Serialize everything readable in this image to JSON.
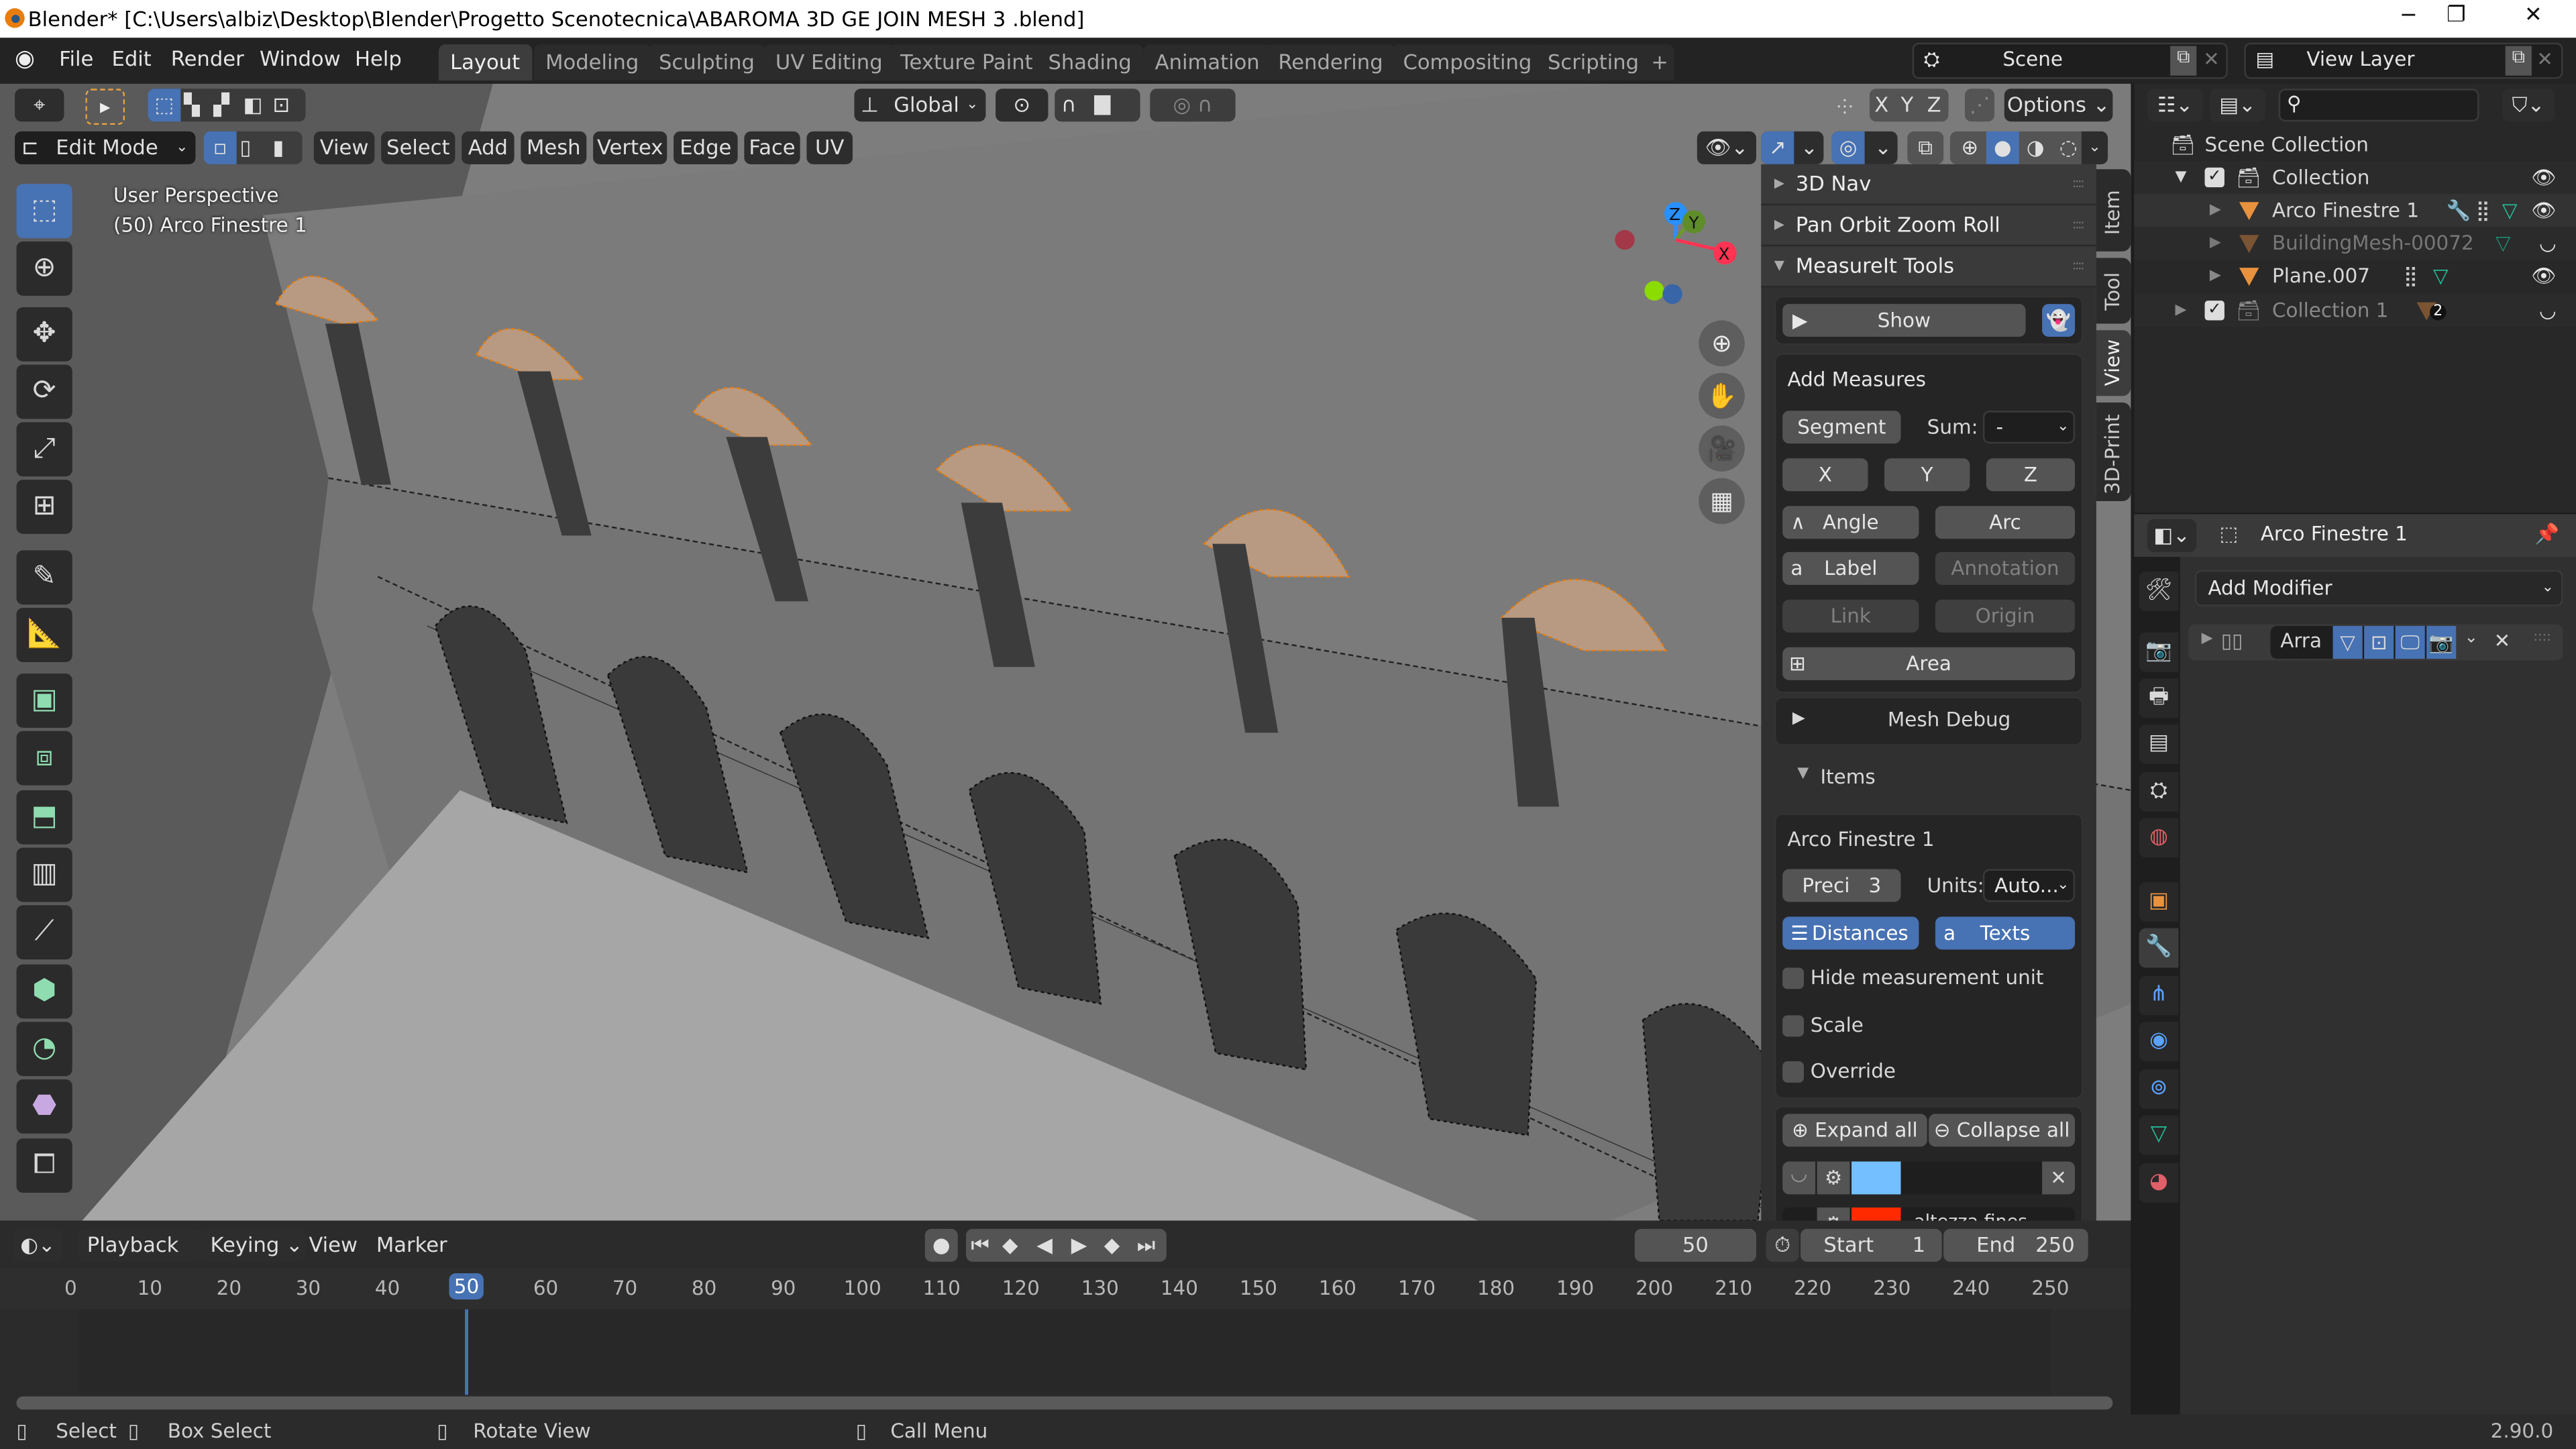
{
  "window": {
    "title": "Blender* [C:\\Users\\albiz\\Desktop\\Blender\\Progetto Scenotecnica\\ABAROMA 3D GE JOIN MESH 3 .blend]",
    "minimize_icon": "−",
    "maximize_icon": "❐",
    "close_icon": "✕"
  },
  "menu": {
    "items": [
      "File",
      "Edit",
      "Render",
      "Window",
      "Help"
    ],
    "workspaces": [
      "Layout",
      "Modeling",
      "Sculpting",
      "UV Editing",
      "Texture Paint",
      "Shading",
      "Animation",
      "Rendering",
      "Compositing",
      "Scripting"
    ],
    "active_workspace": "Layout",
    "add_workspace": "+",
    "scene": "Scene",
    "view_layer": "View Layer"
  },
  "viewport": {
    "mode": "Edit Mode",
    "menus": [
      "View",
      "Select",
      "Add",
      "Mesh",
      "Vertex",
      "Edge",
      "Face",
      "UV"
    ],
    "transform_orientation": "Global",
    "mirror_axes": [
      "X",
      "Y",
      "Z"
    ],
    "options_label": "Options",
    "overlay_text_line1": "User Perspective",
    "overlay_text_line2": "(50) Arco Finestre 1",
    "gizmo": {
      "x": "X",
      "y": "Y",
      "z": "Z",
      "colors": {
        "x": "#ff3352",
        "y": "#8bdc00",
        "z": "#2890ff"
      }
    }
  },
  "toolbar_tools": [
    "Select Box",
    "Cursor",
    "Move",
    "Rotate",
    "Scale",
    "Transform",
    "Annotate",
    "Measure",
    "Extrude Region",
    "Inset Faces",
    "Bevel",
    "Loop Cut",
    "Knife",
    "Poly Build",
    "Spin",
    "Smooth",
    "Edge Slide",
    "Shrink/Fatten"
  ],
  "npanel": {
    "tabs": [
      "Item",
      "Tool",
      "View",
      "3D-Print"
    ],
    "active_tab": "View",
    "sections": [
      {
        "label": "3D Nav",
        "expanded": false
      },
      {
        "label": "Pan Orbit Zoom Roll",
        "expanded": false
      },
      {
        "label": "MeasureIt Tools",
        "expanded": true
      }
    ],
    "show_button": "Show",
    "add_measures": {
      "title": "Add Measures",
      "segment": "Segment",
      "sum_label": "Sum:",
      "sum_value": "-",
      "axes": [
        "X",
        "Y",
        "Z"
      ],
      "angle": "Angle",
      "arc": "Arc",
      "label": "Label",
      "annotation": "Annotation",
      "link": "Link",
      "origin": "Origin",
      "area": "Area"
    },
    "mesh_debug": "Mesh Debug",
    "items_label": "Items",
    "items": {
      "object_name": "Arco Finestre 1",
      "precision_label": "Preci",
      "precision_value": "3",
      "units_label": "Units:",
      "units_value": "Auto...",
      "distances": "Distances",
      "texts": "Texts",
      "checkboxes": [
        {
          "label": "Hide measurement unit",
          "checked": false
        },
        {
          "label": "Scale",
          "checked": false
        },
        {
          "label": "Override",
          "checked": false
        }
      ],
      "expand_all": "Expand all",
      "collapse_all": "Collapse all",
      "measures": [
        {
          "color": "#73bfff",
          "name": ""
        },
        {
          "color": "#ff2a00",
          "name": "altezza fines..."
        }
      ]
    }
  },
  "outliner": {
    "search_placeholder": "",
    "root": "Scene Collection",
    "rows": [
      {
        "name": "Collection",
        "type": "collection",
        "visible": true,
        "checked": true
      },
      {
        "name": "Arco Finestre 1",
        "type": "mesh",
        "visible": true,
        "selected": true
      },
      {
        "name": "BuildingMesh-00072",
        "type": "mesh",
        "visible": false,
        "dimmed": true
      },
      {
        "name": "Plane.007",
        "type": "mesh",
        "visible": true
      },
      {
        "name": "Collection 1",
        "type": "collection",
        "visible": false,
        "checked": true,
        "dimmed": true,
        "badge": "2"
      }
    ]
  },
  "properties": {
    "object_name": "Arco Finestre 1",
    "add_modifier": "Add Modifier",
    "modifier_name": "Arra",
    "tabs": [
      "Tool",
      "Render",
      "Output",
      "View Layer",
      "Scene",
      "World",
      "Object",
      "Modifiers",
      "Particles",
      "Physics",
      "Constraints",
      "Data",
      "Material"
    ],
    "active_tab": "Modifiers"
  },
  "timeline": {
    "menus": [
      "Playback",
      "Keying",
      "View",
      "Marker"
    ],
    "current_frame": "50",
    "start_label": "Start",
    "start": "1",
    "end_label": "End",
    "end": "250",
    "ticks": [
      "0",
      "10",
      "20",
      "30",
      "40",
      "50",
      "60",
      "70",
      "80",
      "90",
      "100",
      "110",
      "120",
      "130",
      "140",
      "150",
      "160",
      "170",
      "180",
      "190",
      "200",
      "210",
      "220",
      "230",
      "240",
      "250"
    ]
  },
  "statusbar": {
    "select": "Select",
    "box_select": "Box Select",
    "rotate_view": "Rotate View",
    "call_menu": "Call Menu",
    "version": "2.90.0"
  },
  "accent_color": "#4772b3"
}
